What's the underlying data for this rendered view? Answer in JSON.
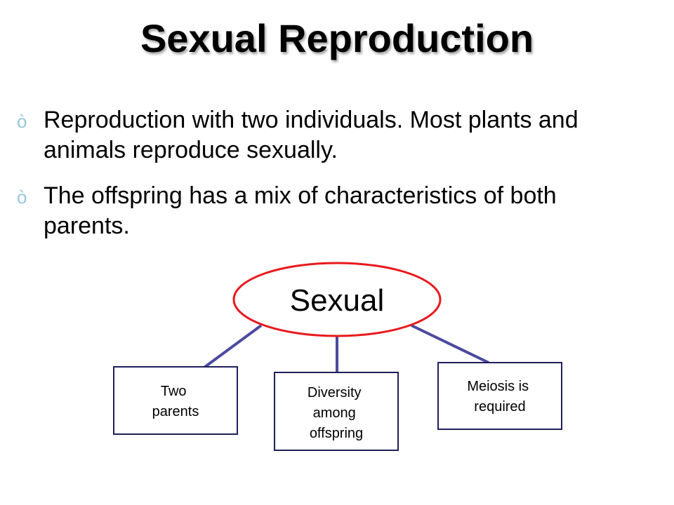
{
  "slide": {
    "title": "Sexual Reproduction",
    "bullet_marker": "ò",
    "bullets": [
      "Reproduction with two individuals.  Most plants and animals reproduce sexually.",
      "The offspring has a mix of characteristics of both parents."
    ]
  },
  "diagram": {
    "root": "Sexual",
    "children": [
      {
        "lines": [
          "Two",
          "parents"
        ]
      },
      {
        "lines": [
          "Diversity",
          "among",
          "offspring"
        ]
      },
      {
        "lines": [
          "Meiosis is",
          "required"
        ]
      }
    ],
    "colors": {
      "oval_border": "#e8191d",
      "box_border": "#1f1f5c",
      "connector": "#4a4aa0",
      "bullet_marker": "#9ac6dc"
    }
  }
}
